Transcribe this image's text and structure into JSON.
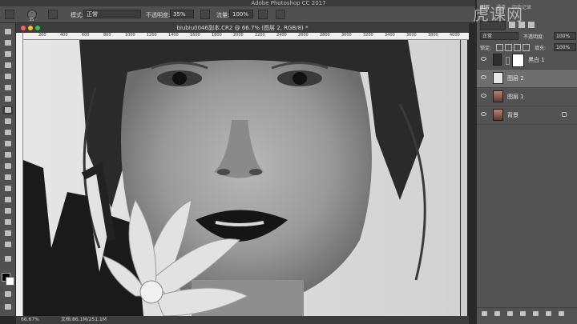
{
  "app": {
    "title": "Adobe Photoshop CC 2017"
  },
  "options": {
    "mode_label": "模式:",
    "mode_value": "正常",
    "opacity_label": "不透明度:",
    "opacity_value": "35%",
    "flow_label": "流量:",
    "flow_value": "100%",
    "brush_size": "35"
  },
  "document": {
    "tab_title": "biubiu0046副本.CR2 @ 66.7% (图层 2, RGB/8) *",
    "ruler_ticks": [
      "200",
      "400",
      "600",
      "800",
      "1000",
      "1200",
      "1400",
      "1600",
      "1800",
      "2000",
      "2200",
      "2400",
      "2600",
      "2800",
      "3000",
      "3200",
      "3400",
      "3600",
      "3800",
      "4000"
    ]
  },
  "status": {
    "zoom": "66.67%",
    "doc_size": "文档:86.1M/251.1M"
  },
  "panel": {
    "tabs": [
      "图层",
      "通道",
      "历史记录"
    ],
    "blend_label": "正常",
    "opacity_label": "不透明度:",
    "opacity_value": "100%",
    "lock_label": "锁定:",
    "fill_label": "填充:",
    "fill_value": "100%",
    "layers": [
      {
        "name": "黑白 1",
        "type": "adjustment",
        "selected": false
      },
      {
        "name": "图层 2",
        "type": "blank",
        "selected": true
      },
      {
        "name": "图层 1",
        "type": "photo",
        "selected": false
      },
      {
        "name": "背景",
        "type": "photo",
        "selected": false,
        "locked": true
      }
    ]
  },
  "watermark": "虎课网",
  "colors": {
    "accent_red": "#fe5f57",
    "accent_yellow": "#febc2e",
    "accent_green": "#28c840",
    "selected_layer": "#6e6e6e"
  }
}
